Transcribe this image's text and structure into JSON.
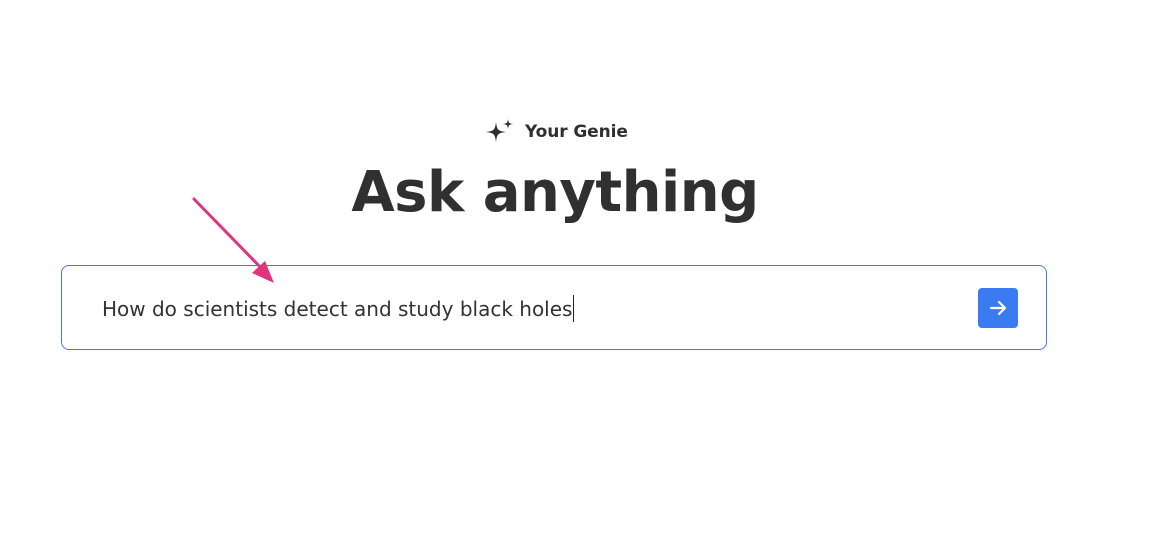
{
  "header": {
    "brand_name": "Your Genie",
    "brand_icon": "sparkles-icon",
    "title": "Ask anything"
  },
  "search": {
    "value": "How do scientists detect and study black holes",
    "submit_icon": "arrow-right-icon"
  },
  "colors": {
    "accent": "#3a7bf2",
    "input_border": "#4a78d6",
    "annotation": "#e0347f",
    "text": "#303030"
  }
}
